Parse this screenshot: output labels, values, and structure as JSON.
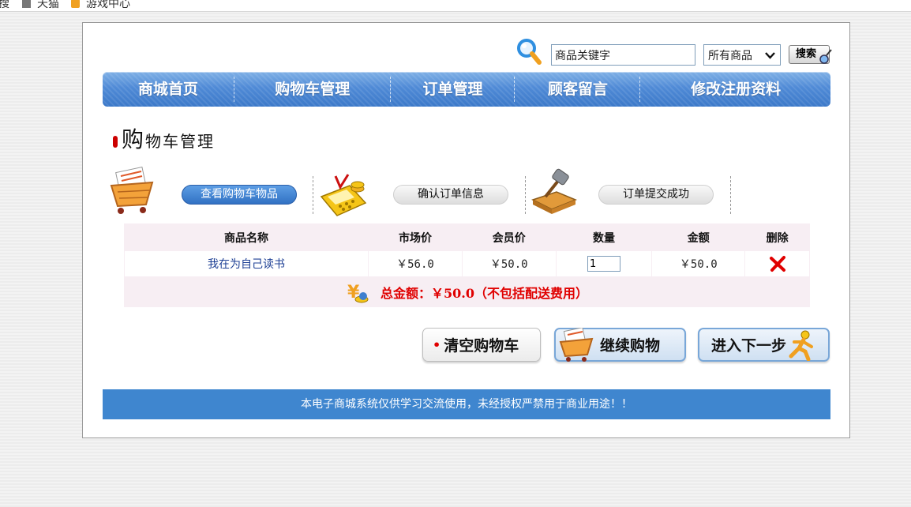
{
  "bookmarks": [
    {
      "label": "搜",
      "icon": ""
    },
    {
      "label": "天猫",
      "icon": "tmall-icon"
    },
    {
      "label": "游戏中心",
      "icon": "game-center-icon"
    }
  ],
  "search": {
    "placeholder": "商品关键字",
    "value": "商品关键字",
    "category_selected": "所有商品",
    "button_label": "搜索"
  },
  "nav": {
    "items": [
      {
        "label": "商城首页"
      },
      {
        "label": "购物车管理"
      },
      {
        "label": "订单管理"
      },
      {
        "label": "顾客留言"
      },
      {
        "label": "修改注册资料"
      }
    ]
  },
  "page": {
    "title_first": "购",
    "title_rest": "物车管理"
  },
  "steps": [
    {
      "label": "查看购物车物品",
      "icon": "shopping-cart-icon",
      "active": true
    },
    {
      "label": "确认订单信息",
      "icon": "calculator-icon",
      "active": false
    },
    {
      "label": "订单提交成功",
      "icon": "gavel-icon",
      "active": false
    }
  ],
  "cart": {
    "headers": {
      "name": "商品名称",
      "market_price": "市场价",
      "member_price": "会员价",
      "quantity": "数量",
      "amount": "金额",
      "delete": "删除"
    },
    "rows": [
      {
        "name": "我在为自己读书",
        "market_price": "￥56.0",
        "member_price": "￥50.0",
        "quantity": "1",
        "amount": "￥50.0"
      }
    ],
    "total_text": "总金额：￥50.0（不包括配送费用）"
  },
  "actions": {
    "clear_label": "清空购物车",
    "continue_label": "继续购物",
    "next_label": "进入下一步"
  },
  "footer": {
    "text": "本电子商城系统仅供学习交流使用，未经授权严禁用于商业用途！！"
  },
  "colors": {
    "nav_blue": "#4f8ad6",
    "footer_blue": "#3f86cf",
    "total_red": "#e00000",
    "link_blue": "#1d3f94"
  }
}
